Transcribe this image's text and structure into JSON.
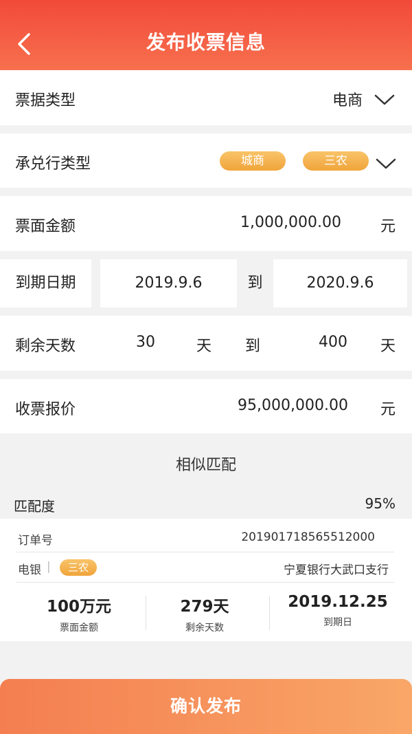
{
  "header": {
    "title": "发布收票信息",
    "back_icon": "chevron-left-icon"
  },
  "bill_type": {
    "label": "票据类型",
    "value": "电商"
  },
  "bank_type": {
    "label": "承兑行类型",
    "tags": [
      "城商",
      "三农"
    ]
  },
  "face_amount": {
    "label": "票面金额",
    "value": "1,000,000.00",
    "unit": "元"
  },
  "due_date": {
    "label": "到期日期",
    "from": "2019.9.6",
    "separator": "到",
    "to": "2020.9.6"
  },
  "remaining_days": {
    "label": "剩余天数",
    "from": "30",
    "from_unit": "天",
    "separator": "到",
    "to": "400",
    "to_unit": "天"
  },
  "quote": {
    "label": "收票报价",
    "value": "95,000,000.00",
    "unit": "元"
  },
  "similar": {
    "title": "相似匹配",
    "match_label": "匹配度",
    "match_value": "95%",
    "order_label": "订单号",
    "order_value": "201901718565512000",
    "bill_kind": "电银",
    "divider": "|",
    "tag": "三农",
    "bank_name": "宁夏银行大武口支行",
    "stats": [
      {
        "value": "100万元",
        "label": "票面金额"
      },
      {
        "value": "279天",
        "label": "剩余天数"
      },
      {
        "value": "2019.12.25",
        "label": "到期日"
      }
    ]
  },
  "confirm_label": "确认发布",
  "colors": {
    "header": "#f24a3a",
    "accent_orange": "#f0a43a",
    "button": "#f47e50"
  }
}
